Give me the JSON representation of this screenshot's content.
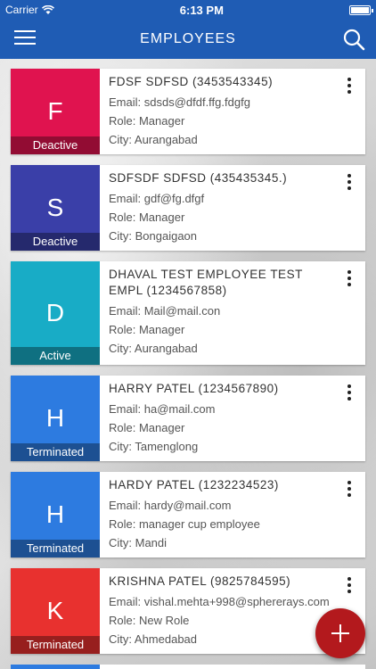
{
  "status_bar": {
    "carrier": "Carrier",
    "time": "6:13 PM"
  },
  "header": {
    "title": "EMPLOYEES"
  },
  "colors": {
    "primary": "#1f5cb4",
    "fab": "#b3191d"
  },
  "icons": {
    "menu": "hamburger-icon",
    "search": "search-icon",
    "more": "more-vertical-icon",
    "add": "plus-icon"
  },
  "employees": [
    {
      "initial": "F",
      "status": "Deactive",
      "color": "#e0134f",
      "name": "FDSF SDFSD (3453543345)",
      "email": "Email: sdsds@dfdf.ffg.fdgfg",
      "role": "Role: Manager",
      "city": "City: Aurangabad"
    },
    {
      "initial": "S",
      "status": "Deactive",
      "color": "#3a3fa8",
      "name": "SDFSDF SDFSD (435435345.)",
      "email": "Email: gdf@fg.dfgf",
      "role": "Role: Manager",
      "city": "City: Bongaigaon"
    },
    {
      "initial": "D",
      "status": "Active",
      "color": "#18acc6",
      "name": "DHAVAL TEST EMPLOYEE TEST EMPL (1234567858)",
      "email": "Email: Mail@mail.con",
      "role": "Role: Manager",
      "city": "City: Aurangabad"
    },
    {
      "initial": "H",
      "status": "Terminated",
      "color": "#2d7be0",
      "name": "HARRY PATEL (1234567890)",
      "email": "Email: ha@mail.com",
      "role": "Role: Manager",
      "city": "City: Tamenglong"
    },
    {
      "initial": "H",
      "status": "Terminated",
      "color": "#2d7be0",
      "name": "HARDY PATEL (1232234523)",
      "email": "Email: hardy@mail.com",
      "role": "Role: manager cup employee",
      "city": "City: Mandi"
    },
    {
      "initial": "K",
      "status": "Terminated",
      "color": "#e8312f",
      "name": "KRISHNA PATEL (9825784595)",
      "email": "Email: vishal.mehta+998@sphererays.com",
      "role": "Role: New Role",
      "city": "City: Ahmedabad"
    }
  ]
}
